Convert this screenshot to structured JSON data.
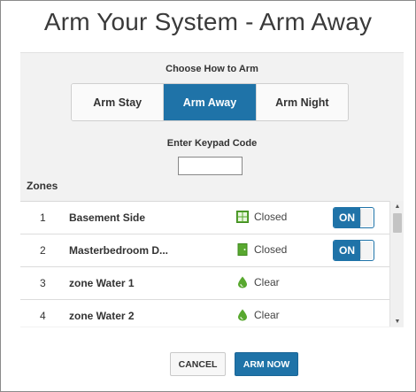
{
  "dialog": {
    "title": "Arm Your System - Arm Away"
  },
  "arm_mode": {
    "label": "Choose How to Arm",
    "options": [
      "Arm Stay",
      "Arm Away",
      "Arm Night"
    ],
    "selected": "Arm Away"
  },
  "keypad": {
    "label": "Enter Keypad Code",
    "value": ""
  },
  "zones": {
    "label": "Zones",
    "items": [
      {
        "num": "1",
        "name": "Basement Side",
        "status": "Closed",
        "icon": "window-icon",
        "toggle": "ON"
      },
      {
        "num": "2",
        "name": "Masterbedroom D...",
        "status": "Closed",
        "icon": "door-icon",
        "toggle": "ON"
      },
      {
        "num": "3",
        "name": "zone Water 1",
        "status": "Clear",
        "icon": "water-drop-icon"
      },
      {
        "num": "4",
        "name": "zone Water 2",
        "status": "Clear",
        "icon": "water-drop-icon"
      }
    ]
  },
  "footer": {
    "cancel_label": "CANCEL",
    "arm_label": "ARM NOW"
  },
  "colors": {
    "accent": "#1f73a8",
    "status_green": "#58a82f"
  }
}
